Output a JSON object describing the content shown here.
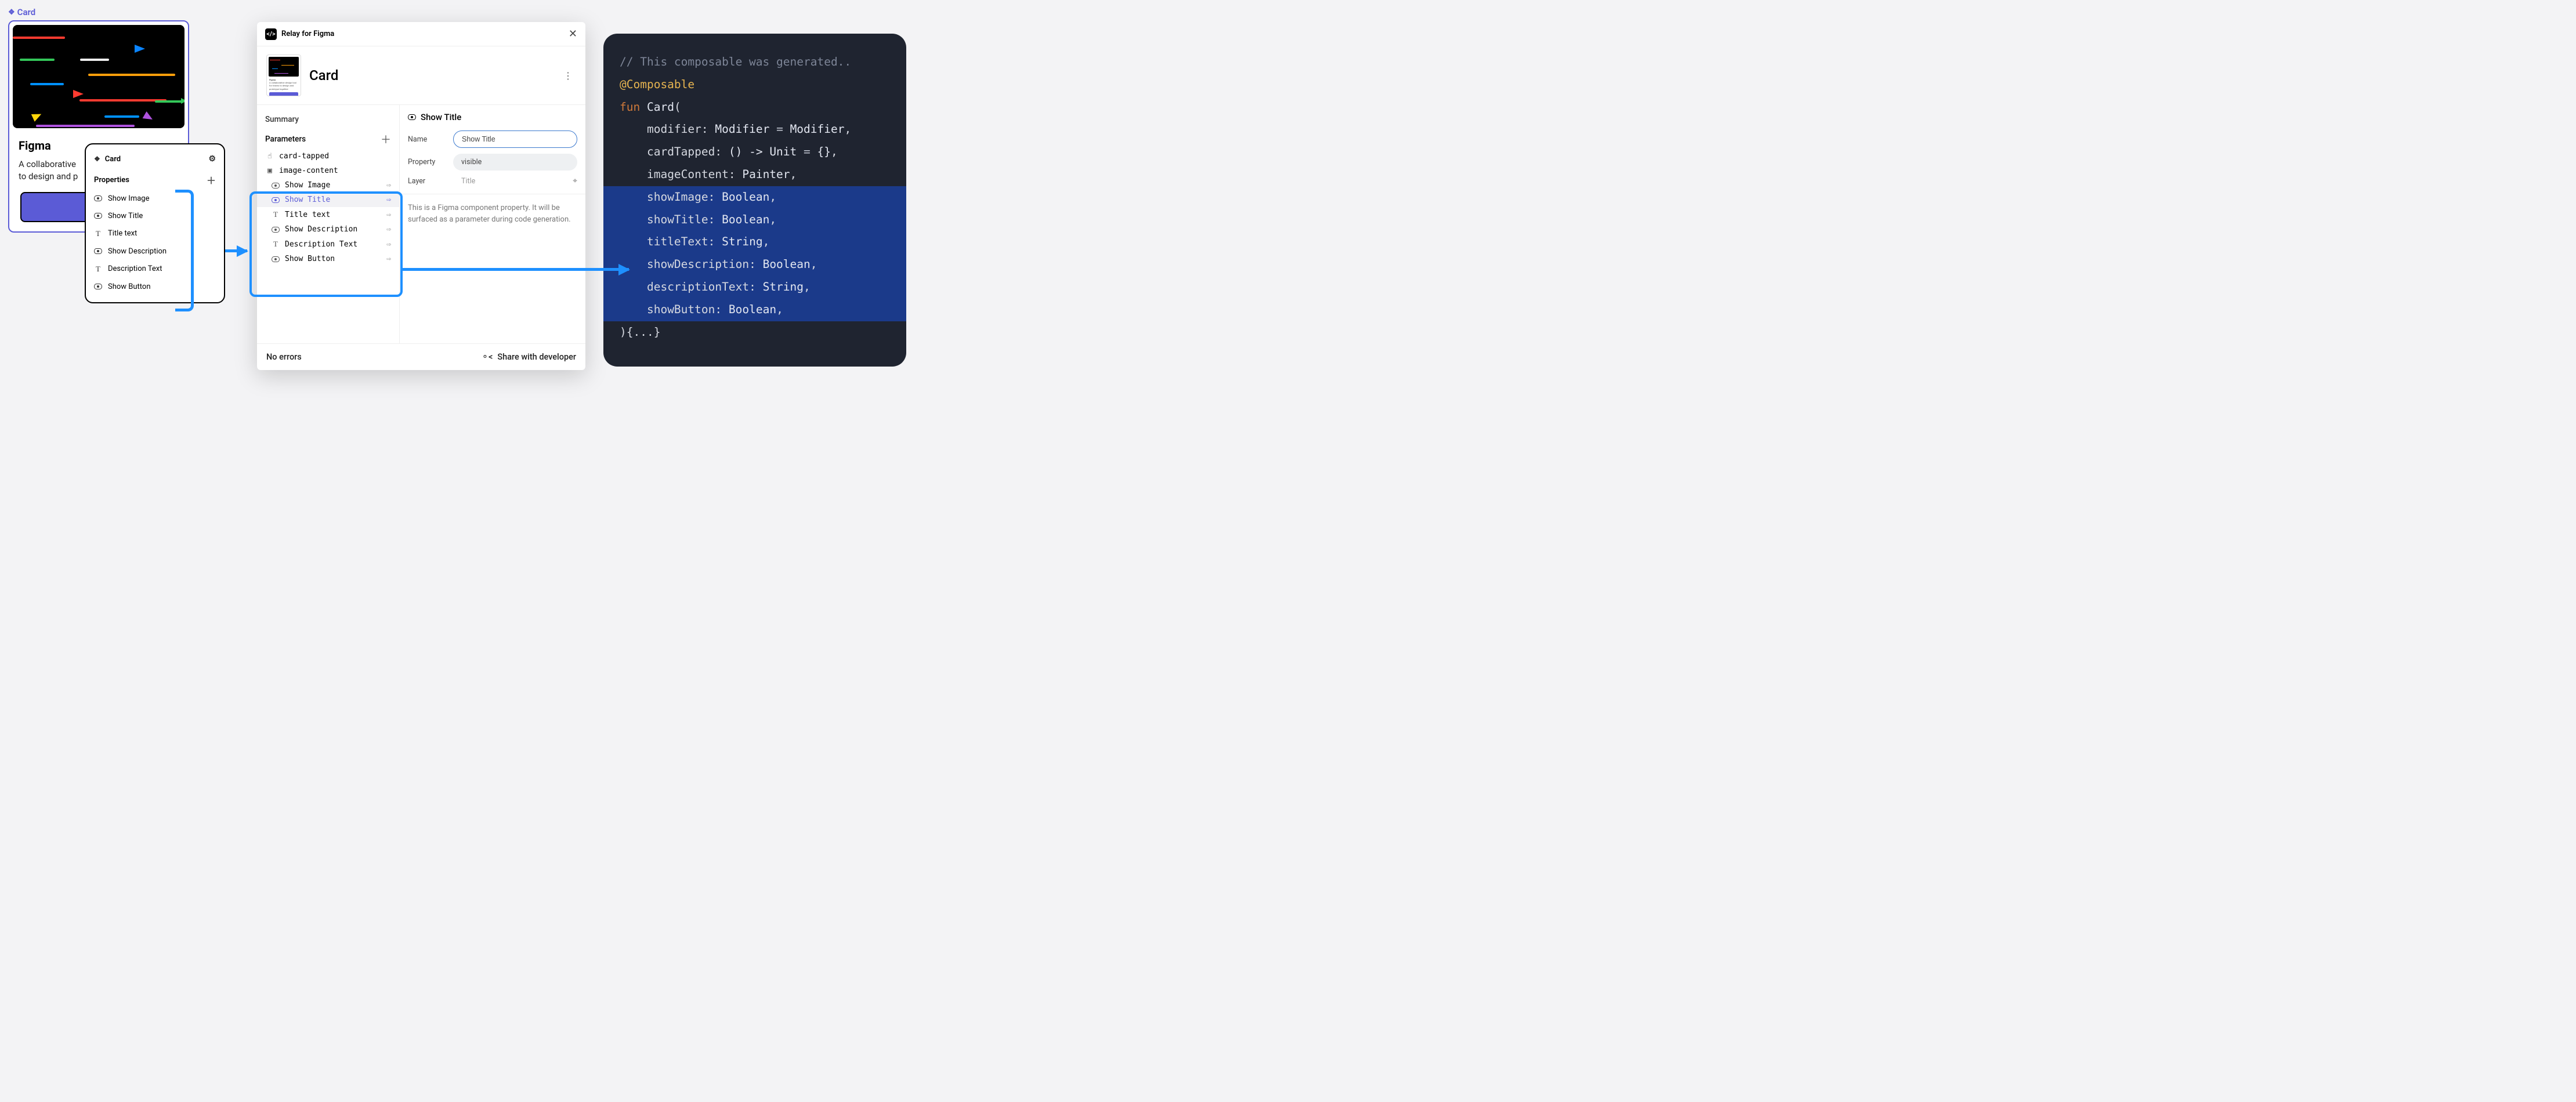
{
  "component_tag": "Card",
  "figma_card": {
    "title": "Figma",
    "desc1": "A collaborative",
    "desc2": "to design and p"
  },
  "props_panel": {
    "title": "Card",
    "section": "Properties",
    "items": [
      {
        "icon": "eye",
        "label": "Show Image"
      },
      {
        "icon": "eye",
        "label": "Show Title"
      },
      {
        "icon": "T",
        "label": "Title text"
      },
      {
        "icon": "eye",
        "label": "Show Description"
      },
      {
        "icon": "T",
        "label": "Description Text"
      },
      {
        "icon": "eye",
        "label": "Show Button"
      }
    ]
  },
  "relay": {
    "app_title": "Relay for Figma",
    "component_title": "Card",
    "thumb": {
      "title": "Figma",
      "desc": "A collaborative design tool for teams to design and prototype together",
      "btn": "Button"
    },
    "left": {
      "summary": "Summary",
      "parameters": "Parameters",
      "params": [
        {
          "icon": "tap",
          "name": "card-tapped",
          "fromprop": false
        },
        {
          "icon": "img",
          "name": "image-content",
          "fromprop": false
        },
        {
          "icon": "eye",
          "name": "Show Image",
          "fromprop": true
        },
        {
          "icon": "eye",
          "name": "Show Title",
          "fromprop": true,
          "selected": true
        },
        {
          "icon": "T",
          "name": "Title text",
          "fromprop": true
        },
        {
          "icon": "eye",
          "name": "Show Description",
          "fromprop": true
        },
        {
          "icon": "T",
          "name": "Description Text",
          "fromprop": true
        },
        {
          "icon": "eye",
          "name": "Show Button",
          "fromprop": true
        }
      ]
    },
    "right": {
      "header": "Show Title",
      "name_label": "Name",
      "name_value": "Show Title",
      "property_label": "Property",
      "property_value": "visible",
      "layer_label": "Layer",
      "layer_value": "Title",
      "help": "This is a Figma component property. It will be surfaced as a parameter during code generation."
    },
    "footer": {
      "errors": "No errors",
      "share": "Share with developer"
    }
  },
  "code": {
    "l1": "// This composable was generated..",
    "l2_ann": "@Composable",
    "l3_kw": "fun",
    "l3_fn": "Card",
    "params": [
      {
        "name": "modifier",
        "type": "Modifier",
        "default": "Modifier",
        "hl": false
      },
      {
        "name": "cardTapped",
        "type": "() -> Unit",
        "default": "{}",
        "hl": false
      },
      {
        "name": "imageContent",
        "type": "Painter",
        "default": null,
        "hl": false
      },
      {
        "name": "showImage",
        "type": "Boolean",
        "default": null,
        "hl": true
      },
      {
        "name": "showTitle",
        "type": "Boolean",
        "default": null,
        "hl": true
      },
      {
        "name": "titleText",
        "type": "String",
        "default": null,
        "hl": true
      },
      {
        "name": "showDescription",
        "type": "Boolean",
        "default": null,
        "hl": true
      },
      {
        "name": "descriptionText",
        "type": "String",
        "default": null,
        "hl": true
      },
      {
        "name": "showButton",
        "type": "Boolean",
        "default": null,
        "hl": true
      }
    ],
    "close": "){...}"
  }
}
